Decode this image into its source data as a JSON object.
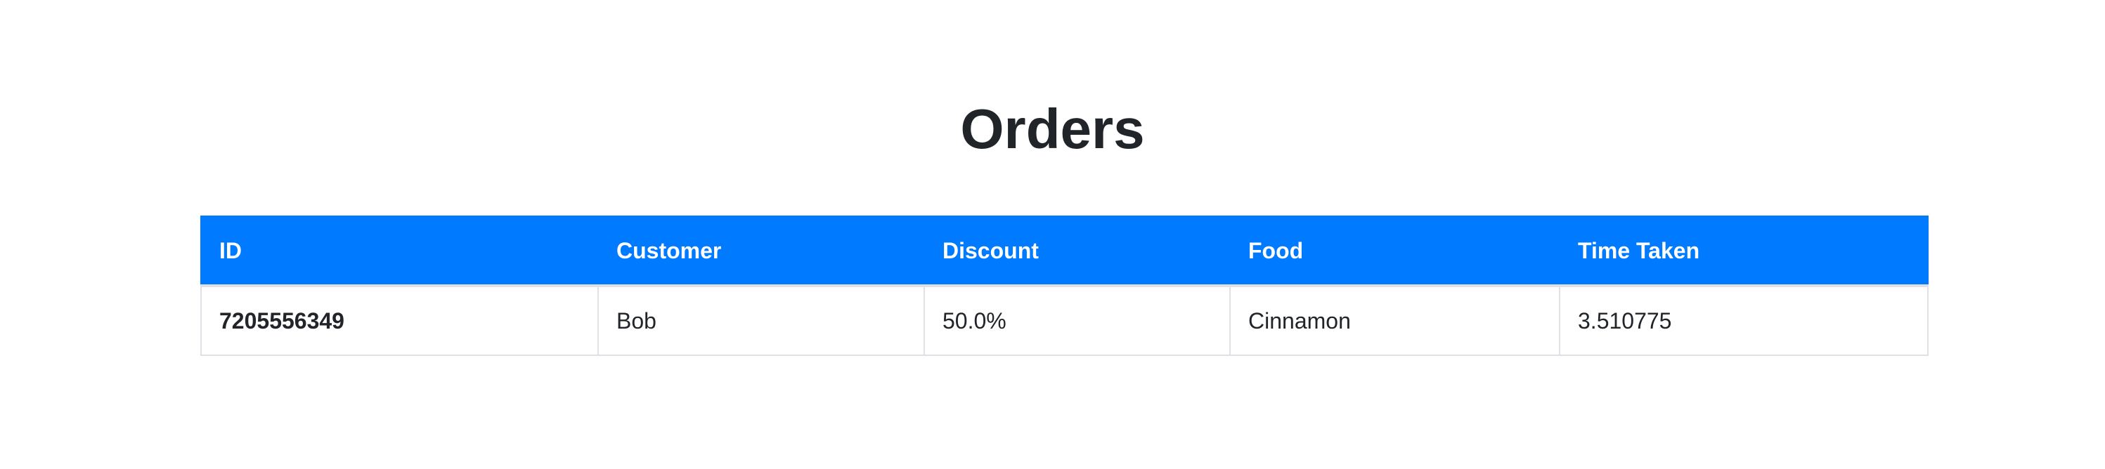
{
  "page": {
    "title": "Orders"
  },
  "table": {
    "headers": [
      "ID",
      "Customer",
      "Discount",
      "Food",
      "Time Taken"
    ],
    "rows": [
      {
        "id": "7205556349",
        "customer": "Bob",
        "discount": "50.0%",
        "food": "Cinnamon",
        "time_taken": "3.510775"
      }
    ]
  },
  "colors": {
    "header_background": "#007bff",
    "header_text": "#ffffff",
    "body_text": "#212529",
    "border": "#dee2e6"
  }
}
